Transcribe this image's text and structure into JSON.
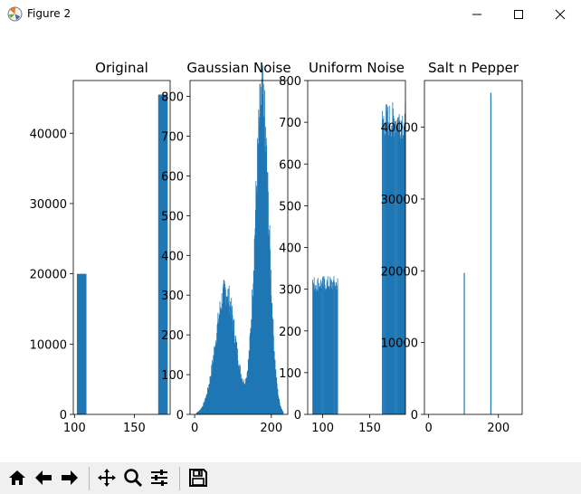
{
  "window": {
    "title": "Figure 2"
  },
  "toolbar": {
    "buttons": [
      "home-icon",
      "back-icon",
      "forward-icon",
      "pan-icon",
      "zoom-icon",
      "configure-subplots-icon",
      "save-icon"
    ]
  },
  "chart_data": [
    {
      "type": "bar",
      "title": "Original",
      "xlabel": "",
      "ylabel": "",
      "xlim": [
        99,
        180
      ],
      "ylim": [
        0,
        47500
      ],
      "xticks": [
        "100",
        "150"
      ],
      "yticks": [
        "0",
        "10000",
        "20000",
        "30000",
        "40000"
      ],
      "series": [
        {
          "values": [
            {
              "x0": 102,
              "x1": 110,
              "y": 20000
            },
            {
              "x0": 170,
              "x1": 178,
              "y": 45500
            }
          ]
        }
      ],
      "color": "#1f77b4"
    },
    {
      "type": "bar",
      "title": "Gaussian Noise",
      "xlabel": "",
      "ylabel": "",
      "xlim": [
        -12,
        243
      ],
      "ylim": [
        0,
        840
      ],
      "xticks": [
        "0",
        "200"
      ],
      "yticks": [
        "0",
        "100",
        "200",
        "300",
        "400",
        "500",
        "600",
        "700",
        "800"
      ],
      "histogram": {
        "mode_left": 80,
        "peak1": 310,
        "mode_right": 175,
        "peak2": 790,
        "range": [
          0,
          230
        ]
      },
      "color": "#1f77b4"
    },
    {
      "type": "bar",
      "title": "Uniform Noise",
      "xlabel": "",
      "ylabel": "",
      "xlim": [
        84,
        188
      ],
      "ylim": [
        0,
        800
      ],
      "xticks": [
        "100",
        "150"
      ],
      "yticks": [
        "0",
        "100",
        "200",
        "300",
        "400",
        "500",
        "600",
        "700",
        "800"
      ],
      "series": [
        {
          "values": [
            {
              "x0": 89,
              "x1": 116,
              "y": 320
            },
            {
              "x0": 163,
              "x1": 188,
              "y": 740
            }
          ]
        }
      ],
      "color": "#1f77b4"
    },
    {
      "type": "bar",
      "title": "Salt n Pepper",
      "xlabel": "",
      "ylabel": "",
      "xlim": [
        -12,
        268
      ],
      "ylim": [
        0,
        46500
      ],
      "xticks": [
        "0",
        "200"
      ],
      "yticks": [
        "0",
        "10000",
        "20000",
        "30000",
        "40000"
      ],
      "series": [
        {
          "values": [
            {
              "x": 102,
              "y": 19700
            },
            {
              "x": 178,
              "y": 44800
            }
          ]
        }
      ],
      "color": "#1f77b4"
    }
  ]
}
